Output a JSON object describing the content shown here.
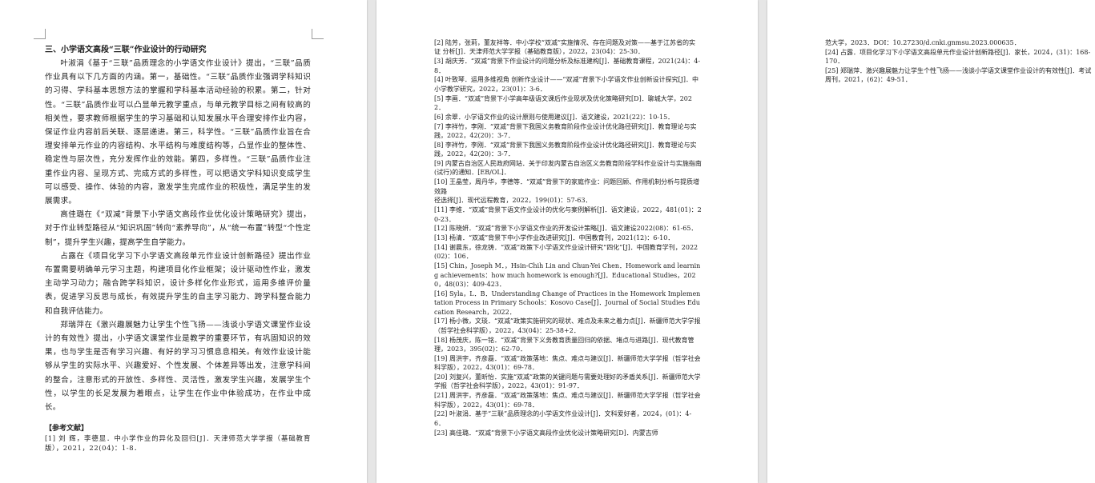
{
  "page1": {
    "heading": "三、小学语文高段“三联”作业设计的行动研究",
    "paragraphs": [
      "叶淑涓《基于“三联”品质理念的小学语文作业设计》提出，“三联”品质作业具有以下几方面的内涵。第一，基础性。“三联”品质作业强调学科知识的习得、学科基本思想方法的掌握和学科基本活动经验的积累。第二，针对性。“三联”品质作业可以凸显单元教学重点，与单元教学目标之间有较高的相关性，要求教师根据学生的学习基础和认知发展水平合理安排作业内容，保证作业内容前后关联、逐层递进。第三，科学性。“三联”品质作业旨在合理安排单元作业的内容结构、水平结构与难度结构等，凸显作业的整体性、稳定性与层次性，充分发挥作业的效能。第四，多样性。“三联”品质作业注重作业内容、呈现方式、完成方式的多样性，可以把语文学科知识变成学生可以感受、操作、体验的内容，激发学生完成作业的积极性，满足学生的发展需求。",
      "高佳璐在《“双减”背景下小学语文高段作业优化设计策略研究》提出，对于作业转型路径从“知识巩固”转向“素养导向”，从“统一布置”转型“个性定制”，提升学生兴趣，提高学生自学能力。",
      "占露在《项目化学习下小学语文高段单元作业设计创新路径》提出作业布置需要明确单元学习主题，构建项目化作业框架；设计驱动性作业，激发主动学习动力；融合跨学科知识，设计多样化作业形式，运用多维评价量表，促进学习反思与成长，有效提升学生的自主学习能力、跨学科整合能力和自我评估能力。",
      "郑瑞萍在《激兴趣展魅力让学生个性飞扬——浅谈小学语文课堂作业设计的有效性》提出，小学语文课堂作业是教学的重要环节，有巩固知识的效果，也与学生是否有学习兴趣、有好的学习习惯息息相关。有效作业设计能够从学生的实际水平、兴趣爱好、个性发展、个体差异等出发，注意学科间的整合，注意形式的开放性、多样性、灵活性，激发学生兴趣，发展学生个性，以学生的长足发展为着眼点，让学生在作业中体验成功，在作业中成长。"
    ],
    "refs_heading": "【参考文献】",
    "refs": [
      "[1] 刘 辉，李德显．中小学作业的异化及回归[J]．天津师范大学学报（基础教育版），2021，22(04)：1-8．"
    ]
  },
  "page2": {
    "refs": [
      "[2] 陆芳，张莉，董友祥等．中小学校“双减”实施情况、存在问题及对策——基于江苏省的实证 分析[J]．天津师范大学学报（基础教育版），2022，23(04)：25-30．",
      "[3] 胡庆芳．“双减”背景下作业设计的问题分析及标准建构[J]．基础教育课程，2021(24)：4-8．",
      "[4] 叶致琴．运用多维视角 创新作业设计——“双减”背景下小学语文作业创新设计探究[J]．中小学教学研究，2022，23(01)：3-6．",
      "[5] 李画．“双减”背景下小学高年级语文课后作业现状及优化策略研究[D]．聊城大学，2022．",
      "[6] 余翠．小学语文作业的设计原则与使用建议[J]．语文建设，2021(22)：10-15．",
      "[7] 李祥竹，李刚．“双减”背景下我国义务教育阶段作业设计优化路径研究[J]．教育理论与实践，2022，42(20)：3-7．",
      "[8] 李祥竹，李刚．“双减”背景下我国义务教育阶段作业设计优化路径研究[J]．教育理论与实践，2022，42(20)：3-7．",
      "[9] 内蒙古自治区人民政府网站．关于印发内蒙古自治区义务教育阶段学科作业设计与实施指南(试行)的通知．[EB/OL]．",
      "[10] 王晶莹，周丹华，李德等．“双减”背景下的家庭作业：问题回顾、作用机制分析与提质增效路",
      "径选择[J]．现代远程教育，2022，199(01)：57-63．",
      "[11] 李维．“双减”背景下语文作业设计的优化与案例解析[J]．语文建设，2022，481(01)：20-23．",
      "[12] 陈晓妍．“双减”背景下小学语文作业的开发设计策略[J]．语文建设2022(08)：61-65．",
      "[13] 杨清．“双减”背景下中小学作业改进研究[J]．中国教育刊，2021(12)：6-10．",
      "[14] 谢晨东，徐龙铸．“双减”政策下小学语文作业设计研究“四化”[J]．中国教育学刊，2022(02)：106．",
      "[15] Chin，Joseph M．，Hsin-Chih Lin and Chun-Yei Chen．Homework and learning achievements：how much homework is enough?[J]．Educational Studies，2020，48(03)：409-423．",
      "[16] Syla，L．B．Understanding Change of Practices in the Homework Implementation Process in Primary Schools：Kosovo Case[J]．Journal of Social Studies Education Research，2022．",
      "[17] 杨小微，文琰．“双减”政策实施研究的现状、难点及未来之着力点[J]．新疆师范大学学报（哲学社会科学版），2022，43(04)：25-38+2．",
      "[18] 杨茂庆，陈一铭．“双减”背景下义务教育质量回归的依据、堵点与进路[J]．现代教育管理，2023，395(02)：62-70．",
      "[19] 周洪宇，齐彦磊．“双减”政策落地：焦点、难点与建议[J]．新疆师范大学学报（哲学社会科学版），2022，43(01)：69-78．",
      "[20] 刘复兴，董昕怡．实施“双减”政策的关键问题与需要处理好的矛盾关系[J]．新疆师范大学学报（哲学社会科学版），2022，43(01)：91-97．",
      "[21] 周洪宇，齐彦磊．“双减”政策落地：焦点、难点与建议[J]．新疆师范大学学报（哲学社会科学版），2022，43(01)：69-78．",
      "[22] 叶淑涓．基于“三联”品质理念的小学语文作业设计[J]．文科爱好者，2024，(01)：4-6．",
      "[23] 高佳璐．“双减”背景下小学语文高段作业优化设计策略研究[D]．内蒙古师"
    ]
  },
  "page3": {
    "refs": [
      "范大学，2023．DOI：10.27230/d.cnki.gnmsu.2023.000635．",
      "[24] 占露．项目化学习下小学语文高段单元作业设计创新路径[J]．家长，2024，(31)：168-170．",
      "[25] 郑瑞萍．激兴趣展魅力让学生个性飞扬——浅谈小学语文课堂作业设计的有效性[J]．考试周刊，2021，(62)：49-51．"
    ]
  }
}
